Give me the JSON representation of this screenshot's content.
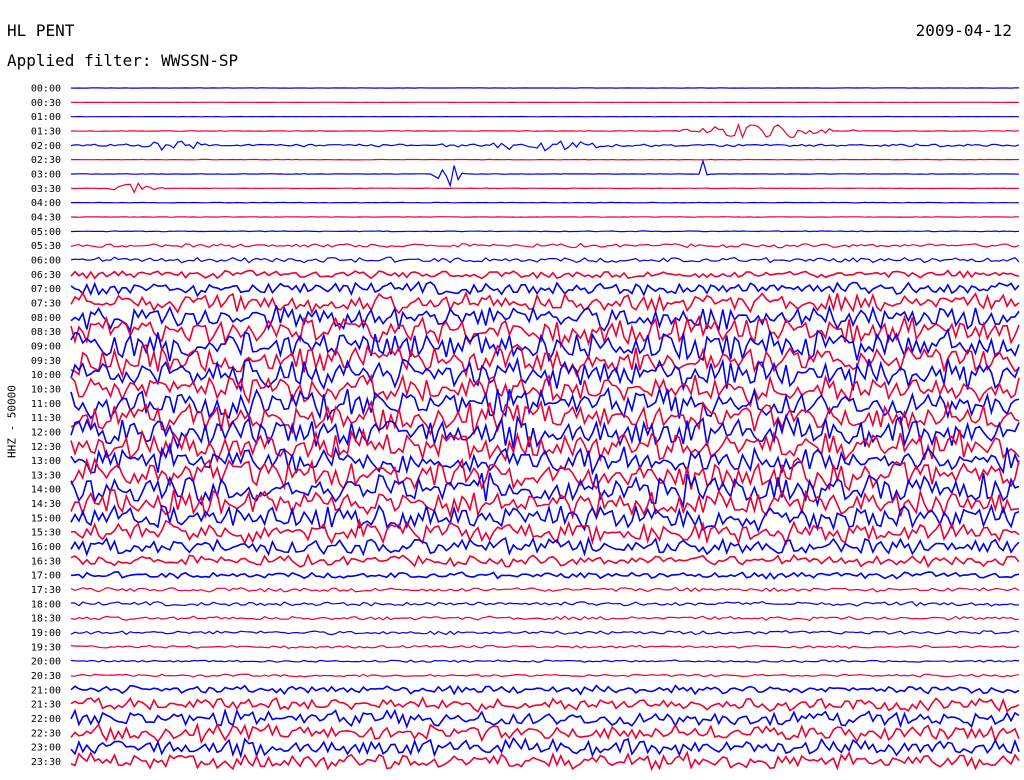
{
  "header": {
    "station": "HL PENT",
    "date": "2009-04-12",
    "filter": "Applied filter: WWSSN-SP"
  },
  "chart_data": {
    "type": "line",
    "title": "HL PENT",
    "subtitle": "Applied filter: WWSSN-SP",
    "ylabel": "HHZ - 50000",
    "xlabel": "",
    "row_labels": [
      "00:00",
      "00:30",
      "01:00",
      "01:30",
      "02:00",
      "02:30",
      "03:00",
      "03:30",
      "04:00",
      "04:30",
      "05:00",
      "05:30",
      "06:00",
      "06:30",
      "07:00",
      "07:30",
      "08:00",
      "08:30",
      "09:00",
      "09:30",
      "10:00",
      "10:30",
      "11:00",
      "11:30",
      "12:00",
      "12:30",
      "13:00",
      "13:30",
      "14:00",
      "14:30",
      "15:00",
      "15:30",
      "16:00",
      "16:30",
      "17:00",
      "17:30",
      "18:00",
      "18:30",
      "19:00",
      "19:30",
      "20:00",
      "20:30",
      "21:00",
      "21:30",
      "22:00",
      "22:30",
      "23:00",
      "23:30"
    ],
    "series_colors": [
      "#0000ee",
      "#ee0033"
    ],
    "relative_noise_amplitude": [
      0.05,
      0.03,
      0.05,
      0.12,
      0.55,
      0.1,
      0.1,
      0.1,
      0.1,
      0.1,
      0.15,
      0.7,
      1.0,
      1.4,
      2.5,
      3.5,
      4.5,
      5,
      5.5,
      5.5,
      5.5,
      5.5,
      5.5,
      5.5,
      5.5,
      5.5,
      5.5,
      5.5,
      5.5,
      5,
      4.5,
      4,
      3,
      2,
      1.2,
      0.8,
      0.8,
      0.7,
      0.7,
      0.5,
      0.4,
      0.5,
      1.5,
      2.5,
      3,
      3,
      3,
      3
    ],
    "events": [
      {
        "row": "01:30",
        "label": "burst",
        "x_min": 22,
        "width_min": 3,
        "strength": 3
      },
      {
        "row": "02:00",
        "label": "burst",
        "x_min": 3,
        "width_min": 1.5,
        "strength": 2
      },
      {
        "row": "02:00",
        "label": "burst",
        "x_min": 15,
        "width_min": 2,
        "strength": 2
      },
      {
        "row": "03:00",
        "label": "spike",
        "x_min": 12,
        "width_min": 0.6,
        "strength": 4
      },
      {
        "row": "03:00",
        "label": "spike",
        "x_min": 20,
        "width_min": 0.15,
        "strength": 5
      },
      {
        "row": "03:30",
        "label": "burst",
        "x_min": 2,
        "width_min": 1,
        "strength": 2
      }
    ]
  }
}
